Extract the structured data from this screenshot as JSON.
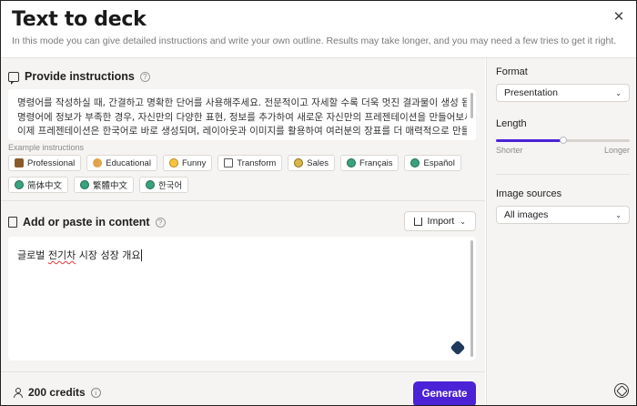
{
  "header": {
    "title": "Text to deck",
    "subtitle": "In this mode you can give detailed instructions and write your own outline. Results may take longer, and you may need a few tries to get it right."
  },
  "instructions": {
    "heading": "Provide instructions",
    "lines": [
      "명령어를 작성하실 때, 간결하고 명확한 단어를 사용해주세요. 전문적이고 자세할 수록 더욱 멋진 결과물이 생성 됩니다.",
      "명령어에 정보가 부족한 경우, 자신만의 다양한 표현, 정보를 추가하여 새로운 자신만의 프레젠테이션을 만들어보세요.",
      "이제 프레젠테이션은 한국어로 바로 생성되며, 레이아웃과 이미지를 활용하여 여러분의 장표를 더 매력적으로 만들어보"
    ],
    "examples_label": "Example instructions",
    "examples": [
      {
        "label": "Professional",
        "icon": "briefcase-icon"
      },
      {
        "label": "Educational",
        "icon": "teacher-icon"
      },
      {
        "label": "Funny",
        "icon": "smiley-icon"
      },
      {
        "label": "Transform",
        "icon": "document-icon"
      },
      {
        "label": "Sales",
        "icon": "coin-icon"
      },
      {
        "label": "Français",
        "icon": "globe-icon"
      },
      {
        "label": "Español",
        "icon": "globe-icon"
      },
      {
        "label": "简体中文",
        "icon": "globe-icon"
      },
      {
        "label": "繁體中文",
        "icon": "globe-icon"
      },
      {
        "label": "한국어",
        "icon": "globe-icon"
      }
    ]
  },
  "content": {
    "heading": "Add or paste in content",
    "import_label": "Import",
    "text_before": "글로벌 ",
    "text_squiggly": "전기차",
    "text_after": " 시장 성장 개요"
  },
  "footer": {
    "credits": "200 credits",
    "generate_label": "Generate"
  },
  "settings": {
    "format_label": "Format",
    "format_value": "Presentation",
    "length_label": "Length",
    "length_min_label": "Shorter",
    "length_max_label": "Longer",
    "length_value": 0.5,
    "image_sources_label": "Image sources",
    "image_sources_value": "All images"
  },
  "colors": {
    "accent": "#4b22d6",
    "panel_bg": "#f6f4f2"
  }
}
